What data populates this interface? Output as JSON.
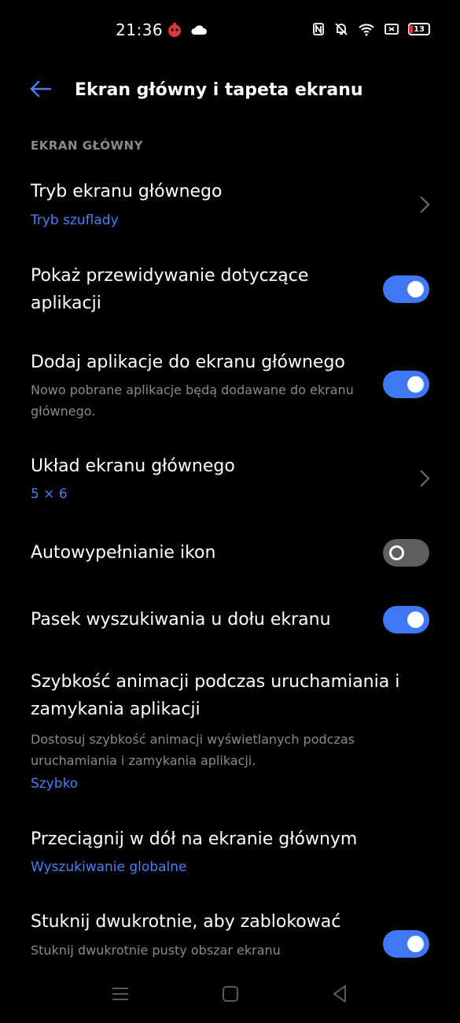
{
  "status_bar": {
    "time": "21:36",
    "battery_level": "13",
    "left_icons": [
      "game-icon",
      "cloud-icon"
    ],
    "right_icons": [
      "nfc-icon",
      "muted-bell-icon",
      "wifi-icon",
      "cast-icon",
      "battery-icon"
    ]
  },
  "header": {
    "title": "Ekran główny i tapeta ekranu",
    "back_icon": "back-arrow-icon"
  },
  "section": {
    "title": "EKRAN GŁÓWNY"
  },
  "settings": {
    "home_mode": {
      "title": "Tryb ekranu głównego",
      "value": "Tryb szuflady"
    },
    "app_suggestions": {
      "title": "Pokaż przewidywanie dotyczące aplikacji",
      "enabled": true
    },
    "add_apps": {
      "title": "Dodaj aplikacje do ekranu głównego",
      "description": "Nowo pobrane aplikacje będą dodawane do ekranu głównego.",
      "enabled": true
    },
    "layout": {
      "title": "Układ ekranu głównego",
      "value": "5 × 6"
    },
    "icon_autofill": {
      "title": "Autowypełnianie ikon",
      "enabled": false
    },
    "search_bar": {
      "title": "Pasek wyszukiwania u dołu ekranu",
      "enabled": true
    },
    "animation_speed": {
      "title": "Szybkość animacji podczas uruchamiania i zamykania aplikacji",
      "description": "Dostosuj szybkość animacji wyświetlanych podczas uruchamiania i zamykania aplikacji.",
      "value": "Szybko"
    },
    "swipe_down": {
      "title": "Przeciągnij w dół na ekranie głównym",
      "value": "Wyszukiwanie globalne"
    },
    "double_tap_lock": {
      "title": "Stuknij dwukrotnie, aby zablokować",
      "description": "Stuknij dwukrotnie pusty obszar ekranu",
      "enabled": true
    }
  },
  "colors": {
    "accent": "#4a7ff5",
    "toggle_on": "#3e78f5",
    "toggle_off": "#5f5f5f",
    "background": "#000000",
    "secondary_text": "#8a8a8a"
  },
  "nav_bar": {
    "icons": [
      "menu-icon",
      "home-icon",
      "back-icon"
    ]
  }
}
